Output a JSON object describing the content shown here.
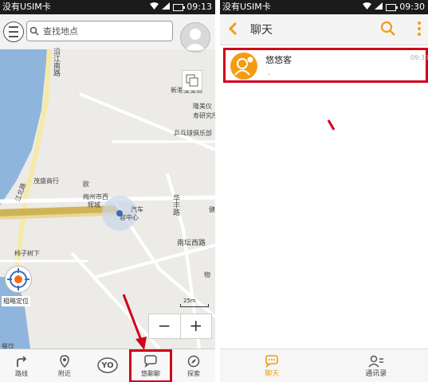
{
  "left_screen": {
    "status": {
      "carrier": "没有USIM卡",
      "time": "09:13"
    },
    "search": {
      "placeholder": "查找地点"
    },
    "map_labels": {
      "road1": "沿江南路",
      "place1": "新港宝宝酒",
      "place2": "隆美仪",
      "place3": "寿研究所",
      "place4": "乒乓球俱乐部",
      "place5": "茂盛商行",
      "place6": "欧",
      "place7": "梅州市西",
      "place8": "辉城",
      "place9": "汽车",
      "place10": "容中心",
      "road2": "华丰路",
      "place11": "健",
      "road3": "南坛西路",
      "place12": "柿子树下",
      "road4": "江北路",
      "place13": "物",
      "place14": "餐饮"
    },
    "locate_label": "粗略定位",
    "scale_text": "25m",
    "zoom": {
      "minus": "−",
      "plus": "+"
    },
    "nav": [
      {
        "label": "路线",
        "icon": "route-icon"
      },
      {
        "label": "附近",
        "icon": "nearby-pin-icon"
      },
      {
        "label": "",
        "icon": "yo-icon",
        "badge": "YO"
      },
      {
        "label": "悠聊聊",
        "icon": "chat-bubble-icon"
      },
      {
        "label": "探索",
        "icon": "compass-icon"
      }
    ]
  },
  "right_screen": {
    "status": {
      "carrier": "没有USIM卡",
      "time": "09:30"
    },
    "header": {
      "title": "聊天"
    },
    "conversation": {
      "name": "悠悠客",
      "time": "09:33",
      "preview": "."
    },
    "nav": [
      {
        "label": "聊天",
        "icon": "chat-icon"
      },
      {
        "label": "通讯录",
        "icon": "contacts-icon"
      }
    ]
  },
  "colors": {
    "accent": "#f39c12",
    "highlight": "#d0011b",
    "statusbar": "#1b1b1b"
  }
}
